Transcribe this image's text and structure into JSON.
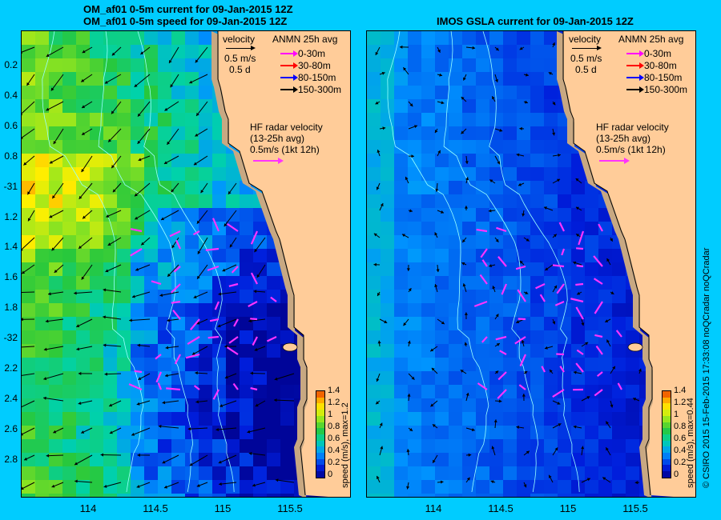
{
  "left_title_1": "OM_af01 0-5m current for 09-Jan-2015 12Z",
  "left_title_2": "OM_af01 0-5m speed for 09-Jan-2015 12Z",
  "right_title": "IMOS GSLA current for 09-Jan-2015 12Z",
  "y_ticks": [
    "0.2",
    "0.4",
    "0.6",
    "0.8",
    "-31",
    "1.2",
    "1.4",
    "1.6",
    "1.8",
    "-32",
    "2.2",
    "2.4",
    "2.6",
    "2.8"
  ],
  "x_ticks": [
    "114",
    "114.5",
    "115",
    "115.5"
  ],
  "legend": {
    "velocity_label": "velocity",
    "velocity_scale": "0.5 m/s",
    "velocity_time": "0.5 d",
    "anmn_title": "ANMN 25h avg",
    "anmn_items": [
      {
        "label": "0-30m",
        "color": "#ff00ff"
      },
      {
        "label": "30-80m",
        "color": "#ff0000"
      },
      {
        "label": "80-150m",
        "color": "#0000ff"
      },
      {
        "label": "150-300m",
        "color": "#000000"
      }
    ],
    "hf_title": "HF radar velocity",
    "hf_sub": "(13-25h avg)",
    "hf_scale": "0.5m/s (1kt 12h)"
  },
  "colorbar": {
    "ticks": [
      "1.4",
      "1.2",
      "1",
      "0.8",
      "0.6",
      "0.4",
      "0.2",
      "0"
    ],
    "left_label": "speed (m/s), max=1.2",
    "right_label": "speed (m/s), max=0.44"
  },
  "credit": "© CSIRO 2015   15-Feb-2015 17:33:08 noQCradar noQCradar",
  "colors": {
    "background": "#00ccff",
    "land": "#ffcc99",
    "coast_sand": "#c8a882",
    "hf_radar": "#ff33ff"
  }
}
